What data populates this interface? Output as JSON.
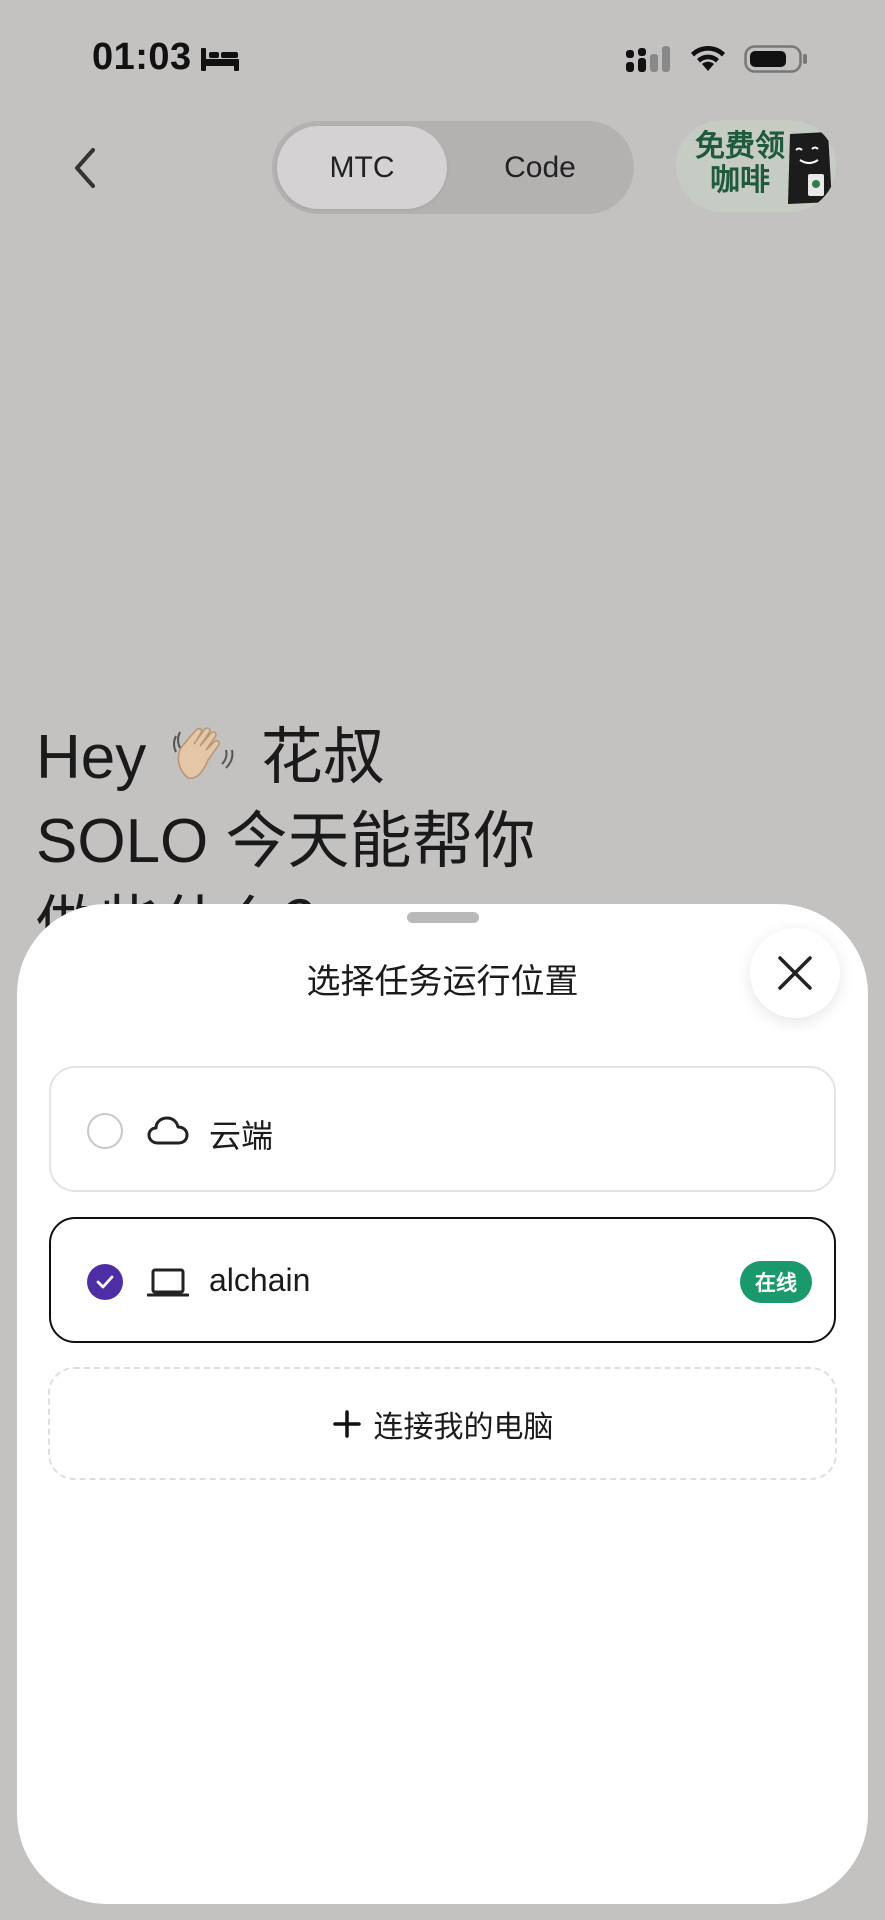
{
  "status_bar": {
    "time": "01:03",
    "icons": [
      "bed-icon",
      "signal-icon",
      "wifi-icon",
      "battery-icon"
    ]
  },
  "header": {
    "back_icon": "chevron-left-icon",
    "tabs": [
      {
        "label": "MTC",
        "active": true
      },
      {
        "label": "Code",
        "active": false
      }
    ],
    "promo": {
      "label": "免费领咖啡",
      "icon": "coffee-cup-icon"
    }
  },
  "greeting": {
    "line1_prefix": "Hey",
    "emoji": "waving-hand",
    "name": "花叔",
    "line2": "SOLO 今天能帮你",
    "line3": "做些什么？"
  },
  "sheet": {
    "title": "选择任务运行位置",
    "close_icon": "close-icon",
    "options": [
      {
        "label": "云端",
        "icon": "cloud-icon",
        "selected": false
      },
      {
        "label": "alchain",
        "icon": "laptop-icon",
        "selected": true,
        "badge": "在线"
      }
    ],
    "connect_label": "连接我的电脑"
  },
  "colors": {
    "backdrop": "#c4c1c1",
    "accent_purple": "#4f2ea5",
    "online_green": "#1a9a6c",
    "promo_green": "#1f5a3c"
  }
}
